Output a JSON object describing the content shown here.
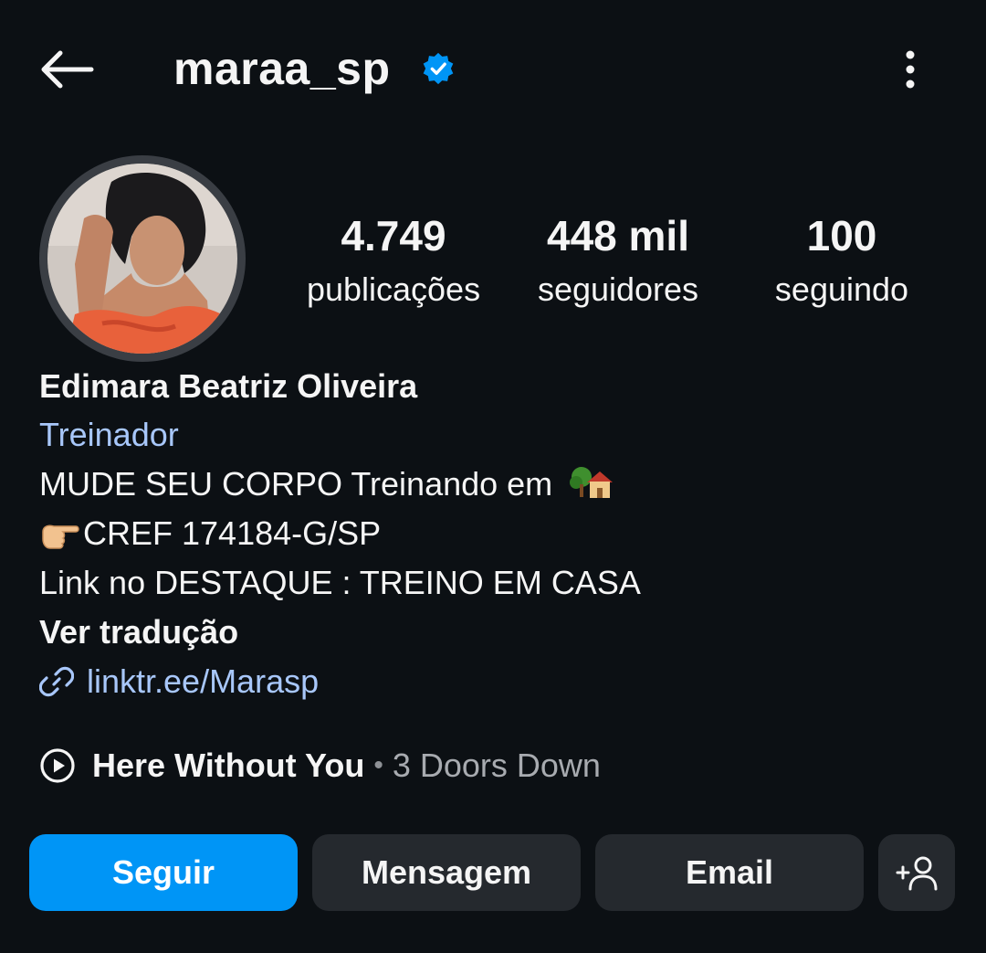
{
  "header": {
    "username": "maraa_sp",
    "verified": true,
    "back_icon": "arrow-left-icon",
    "more_icon": "more-vertical-icon"
  },
  "profile": {
    "avatar": "profile-photo",
    "stats": {
      "posts": {
        "value": "4.749",
        "label": "publicações"
      },
      "followers": {
        "value": "448 mil",
        "label": "seguidores"
      },
      "following": {
        "value": "100",
        "label": "seguindo"
      }
    }
  },
  "bio": {
    "full_name": "Edimara Beatriz Oliveira",
    "category": "Treinador",
    "line1": "MUDE SEU CORPO Treinando em ",
    "line1_emoji": "tree-house-emoji",
    "line2_emoji": "pointing-hand-emoji",
    "line2": "CREF 174184-G/SP",
    "line3": "Link no DESTAQUE : TREINO EM CASA",
    "translate_label": "Ver tradução",
    "link": "linktr.ee/Marasp"
  },
  "music": {
    "song": "Here Without You",
    "separator": "•",
    "artist": "3 Doors Down"
  },
  "actions": {
    "follow_label": "Seguir",
    "message_label": "Mensagem",
    "email_label": "Email",
    "suggest_icon": "add-person-icon"
  },
  "colors": {
    "background": "#0c1014",
    "accent": "#0095f6",
    "link": "#a8c7fa",
    "button_secondary": "#25292e",
    "verified": "#0095f6"
  }
}
